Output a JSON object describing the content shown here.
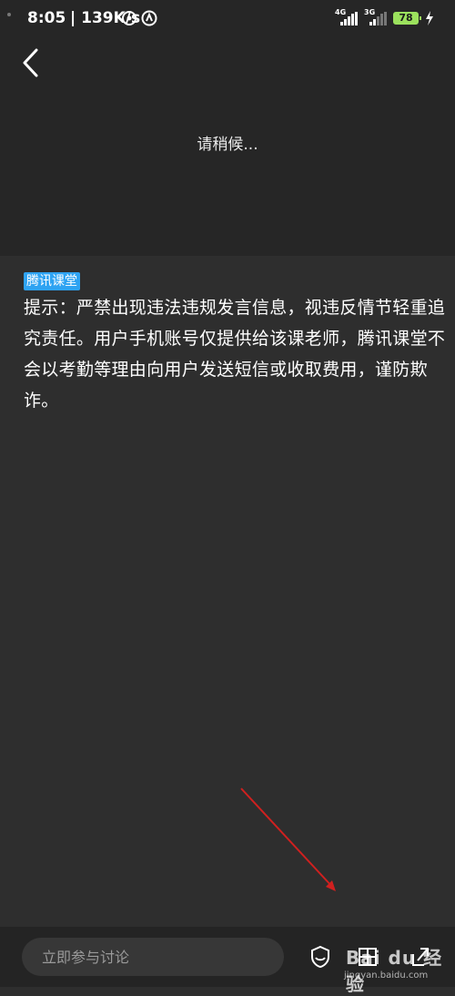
{
  "status_bar": {
    "time": "8:05",
    "speed": "139K/s",
    "network_left": "4G",
    "network_right": "3G",
    "battery": "78"
  },
  "header": {
    "loading_text": "请稍候..."
  },
  "notice": {
    "badge": "腾讯课堂",
    "text": "提示：严禁出现违法违规发言信息，视违反情节轻重追究责任。用户手机账号仅提供给该课老师，腾讯课堂不会以考勤等理由向用户发送短信或收取费用，谨防欺诈。"
  },
  "bottom_bar": {
    "input_placeholder": "立即参与讨论",
    "icons": [
      "shield-icon",
      "grid-icon",
      "expand-icon"
    ]
  },
  "watermark": {
    "logo": "Bai du 经验",
    "url": "jingyan.baidu.com"
  },
  "colors": {
    "background": "#2e2e2e",
    "top_area": "#262626",
    "badge": "#2ea3f2",
    "battery": "#9be15d",
    "annotation_arrow": "#d0201f"
  }
}
